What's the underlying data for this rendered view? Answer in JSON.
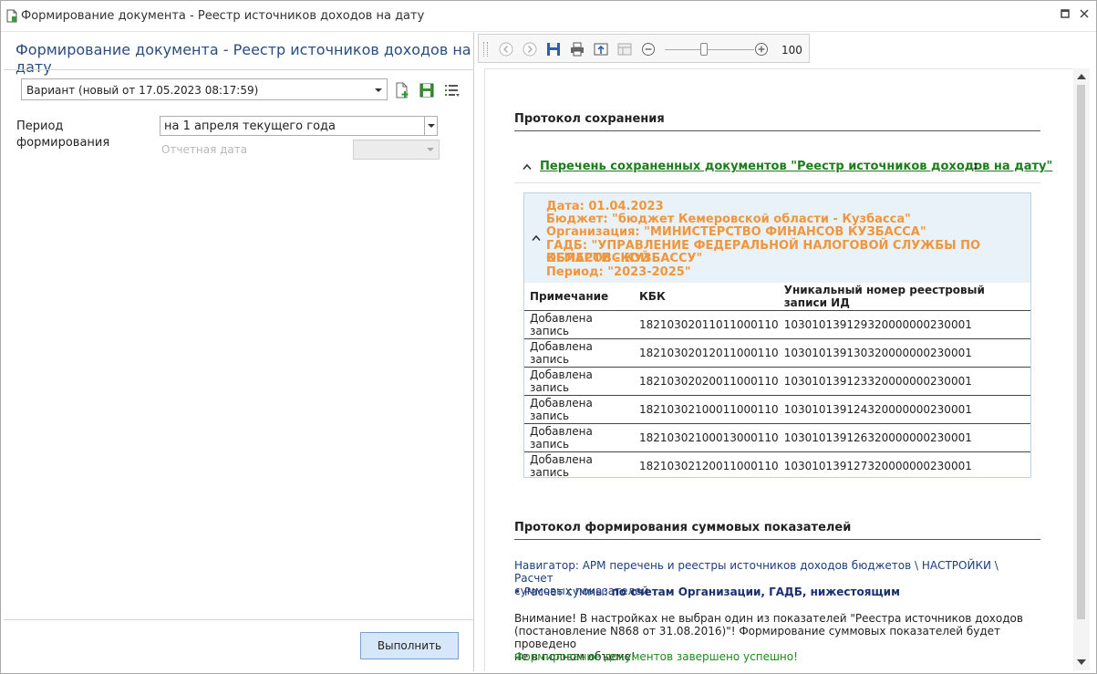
{
  "window": {
    "title": "Формирование документа - Реестр источников доходов на дату"
  },
  "left_panel": {
    "heading": "Формирование документа - Реестр источников доходов на дату",
    "variant": "Вариант (новый от 17.05.2023 08:17:59)",
    "period_label": "Период формирования",
    "period_value": "на 1 апреля текущего года",
    "report_date_label": "Отчетная дата",
    "run_button": "Выполнить"
  },
  "toolbar": {
    "zoom": "100",
    "icons": [
      "back-icon",
      "forward-icon",
      "save-icon",
      "print-icon",
      "export-icon",
      "layout-icon",
      "zoom-out-icon",
      "zoom-in-icon"
    ]
  },
  "report": {
    "save_protocol_title": "Протокол сохранения",
    "saved_docs_link": "Перечень сохраненных документов \"Реестр источников доходов на дату\"",
    "saved_docs_colon": ":",
    "group": {
      "date": "Дата: 01.04.2023",
      "budget": "Бюджет: \"бюджет Кемеровской области - Кузбасса\"",
      "organization": "Организация: \"МИНИСТЕРСТВО ФИНАНСОВ КУЗБАССА\"",
      "gadb_line1": "ГАДБ: \"УПРАВЛЕНИЕ ФЕДЕРАЛЬНОЙ НАЛОГОВОЙ СЛУЖБЫ ПО КЕМЕРОВСКОЙ",
      "gadb_line2": "ОБЛАСТИ - КУЗБАССУ\"",
      "period": "Период: \"2023-2025\""
    },
    "table": {
      "headers": [
        "Примечание",
        "КБК",
        "Уникальный номер реестровый записи ИД"
      ],
      "rows": [
        [
          "Добавлена запись",
          "18210302011011000110",
          "103010139129320000000230001"
        ],
        [
          "Добавлена запись",
          "18210302012011000110",
          "103010139130320000000230001"
        ],
        [
          "Добавлена запись",
          "18210302020011000110",
          "103010139123320000000230001"
        ],
        [
          "Добавлена запись",
          "18210302100011000110",
          "103010139124320000000230001"
        ],
        [
          "Добавлена запись",
          "18210302100013000110",
          "103010139126320000000230001"
        ],
        [
          "Добавлена запись",
          "18210302120011000110",
          "103010139127320000000230001"
        ]
      ]
    },
    "sum_protocol_title": "Протокол формирования суммовых показателей",
    "navigator_line1": "Навигатор: АРМ перечень и реестры источников доходов бюджетов \\ НАСТРОЙКИ \\ Расчет",
    "navigator_line2": "суммовых показателей",
    "calc_label": "• Расчет суммы: ",
    "calc_value": "по счетам Организации, ГАДБ, нижестоящим",
    "warning_line1": "Внимание! В настройках не выбран один из показателей \"Реестра источников доходов",
    "warning_line2": "(постановление N868 от 31.08.2016)\"! Формирование суммовых показателей будет проведено",
    "warning_line3": "не в полном объеме!",
    "success": "Формирование документов завершено успешно!"
  },
  "colors": {
    "heading_blue": "#2b4c7e",
    "link_green": "#1c7d1c",
    "meta_orange": "#f0963c",
    "header_bg": "#e9f2f9",
    "success_green": "#1c8a1c"
  }
}
